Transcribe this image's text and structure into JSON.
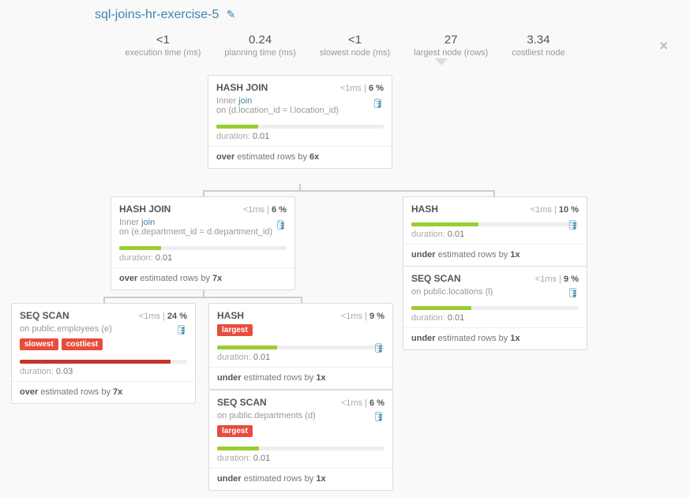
{
  "title": "sql-joins-hr-exercise-5",
  "metrics": {
    "exec_time": {
      "value": "<1",
      "label": "execution time (ms)"
    },
    "plan_time": {
      "value": "0.24",
      "label": "planning time (ms)"
    },
    "slowest": {
      "value": "<1",
      "label": "slowest node (ms)"
    },
    "largest": {
      "value": "27",
      "label": "largest node (rows)"
    },
    "costliest": {
      "value": "3.34",
      "label": "costliest node"
    }
  },
  "labels": {
    "duration": "duration:",
    "on": "on",
    "join": "join",
    "estimated_rows_by": "estimated rows by"
  },
  "nodes": {
    "n1": {
      "name": "HASH JOIN",
      "time": "<1ms",
      "pct": "6 %",
      "join_type": "Inner",
      "on": "(d.location_id = l.location_id)",
      "bar_pct": 25,
      "bar_color": "green",
      "duration": "0.01",
      "est_dir": "over",
      "est_mult": "6x"
    },
    "n2": {
      "name": "HASH JOIN",
      "time": "<1ms",
      "pct": "6 %",
      "join_type": "Inner",
      "on": "(e.department_id = d.department_id)",
      "bar_pct": 25,
      "bar_color": "green",
      "duration": "0.01",
      "est_dir": "over",
      "est_mult": "7x"
    },
    "n3": {
      "name": "HASH",
      "time": "<1ms",
      "pct": "10 %",
      "bar_pct": 40,
      "bar_color": "green",
      "duration": "0.01",
      "est_dir": "under",
      "est_mult": "1x"
    },
    "n4": {
      "name": "SEQ SCAN",
      "time": "<1ms",
      "pct": "9 %",
      "relation": "public.locations (l)",
      "bar_pct": 36,
      "bar_color": "green",
      "duration": "0.01",
      "est_dir": "under",
      "est_mult": "1x"
    },
    "n5": {
      "name": "SEQ SCAN",
      "time": "<1ms",
      "pct": "24 %",
      "relation": "public.employees (e)",
      "tags": [
        "slowest",
        "costliest"
      ],
      "bar_pct": 90,
      "bar_color": "red",
      "duration": "0.03",
      "est_dir": "over",
      "est_mult": "7x"
    },
    "n6": {
      "name": "HASH",
      "time": "<1ms",
      "pct": "9 %",
      "tags": [
        "largest"
      ],
      "bar_pct": 36,
      "bar_color": "green",
      "duration": "0.01",
      "est_dir": "under",
      "est_mult": "1x"
    },
    "n7": {
      "name": "SEQ SCAN",
      "time": "<1ms",
      "pct": "6 %",
      "relation": "public.departments (d)",
      "tags": [
        "largest"
      ],
      "bar_pct": 25,
      "bar_color": "green",
      "duration": "0.01",
      "est_dir": "under",
      "est_mult": "1x"
    }
  }
}
